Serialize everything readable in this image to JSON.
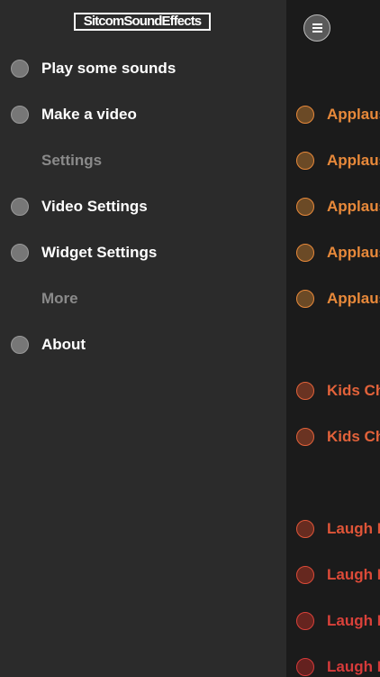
{
  "app": {
    "logo_text": "SitcomSoundEffects"
  },
  "drawer": {
    "items": [
      {
        "label": "Play some sounds"
      },
      {
        "label": "Make a video"
      },
      {
        "section": "Settings"
      },
      {
        "label": "Video Settings"
      },
      {
        "label": "Widget Settings"
      },
      {
        "section": "More"
      },
      {
        "label": "About"
      }
    ]
  },
  "main": {
    "menu_icon": "hamburger-menu-icon",
    "sounds": [
      {
        "label": "Applaus",
        "color": "#e8893a",
        "dot": "#6b4a26"
      },
      {
        "label": "Applaus",
        "color": "#e8893a",
        "dot": "#6b4a26"
      },
      {
        "label": "Applaus",
        "color": "#e8893a",
        "dot": "#6b4a26"
      },
      {
        "label": "Applaus",
        "color": "#e8893a",
        "dot": "#6b4a26"
      },
      {
        "label": "Applaus",
        "color": "#e8893a",
        "dot": "#6b4a26"
      },
      {
        "label": "Kids Ch",
        "color": "#e2623a",
        "dot": "#6a3322"
      },
      {
        "label": "Kids Ch",
        "color": "#e2623a",
        "dot": "#6a3322"
      },
      {
        "label": "Laugh I",
        "color": "#df5538",
        "dot": "#672c20"
      },
      {
        "label": "Laugh I",
        "color": "#dc4a38",
        "dot": "#66281f"
      },
      {
        "label": "Laugh I",
        "color": "#d9413a",
        "dot": "#66241f"
      },
      {
        "label": "Laugh I",
        "color": "#d63a3a",
        "dot": "#64211f"
      }
    ]
  },
  "colors": {
    "drawer_bg": "#2b2b2b",
    "main_bg": "#1b1b1b",
    "section_header": "#8a8a8a"
  }
}
